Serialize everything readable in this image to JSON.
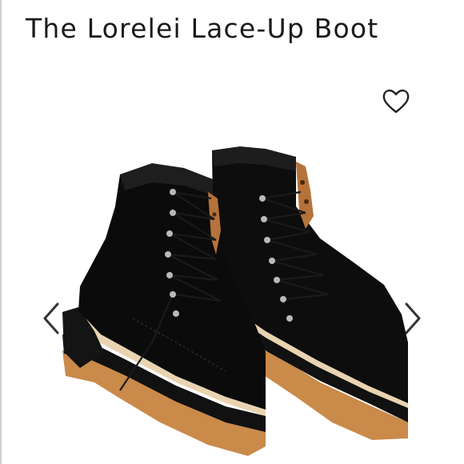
{
  "product": {
    "title": "The Lorelei Lace-Up Boot"
  },
  "controls": {
    "favorite_icon": "heart-outline-icon",
    "prev_icon": "chevron-left-icon",
    "next_icon": "chevron-right-icon"
  },
  "image": {
    "subject": "product-photo-boots",
    "colors": {
      "suede": "#0d0d0d",
      "sole_tan": "#c98a4a",
      "lining_leopard": "#b5733a",
      "welt_cream": "#e9d3b0",
      "eyelet_silver": "#b9b9b9"
    }
  }
}
